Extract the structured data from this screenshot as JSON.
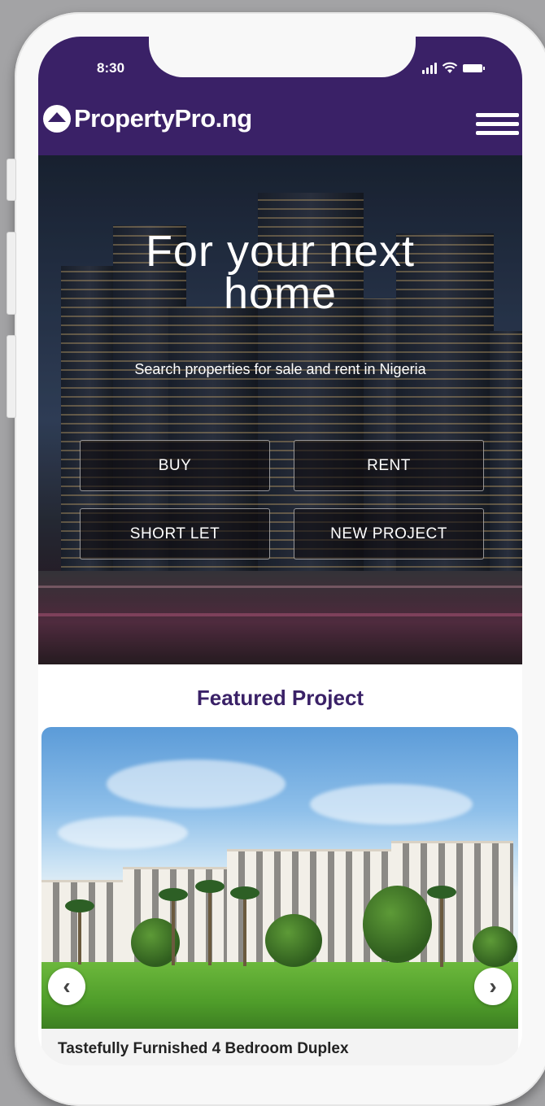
{
  "status": {
    "time": "8:30"
  },
  "header": {
    "logo_text": "PropertyPro.ng",
    "menu_icon": "hamburger-menu-icon"
  },
  "hero": {
    "title_line1": "For your next",
    "title_line2": "home",
    "subtitle": "Search properties for sale and rent in Nigeria",
    "buttons": [
      "BUY",
      "RENT",
      "SHORT LET",
      "NEW PROJECT"
    ]
  },
  "featured": {
    "title": "Featured Project",
    "caption": "Tastefully Furnished 4 Bedroom Duplex",
    "prev_icon": "chevron-left-icon",
    "next_icon": "chevron-right-icon"
  },
  "colors": {
    "brand": "#3a2167",
    "white": "#ffffff"
  }
}
